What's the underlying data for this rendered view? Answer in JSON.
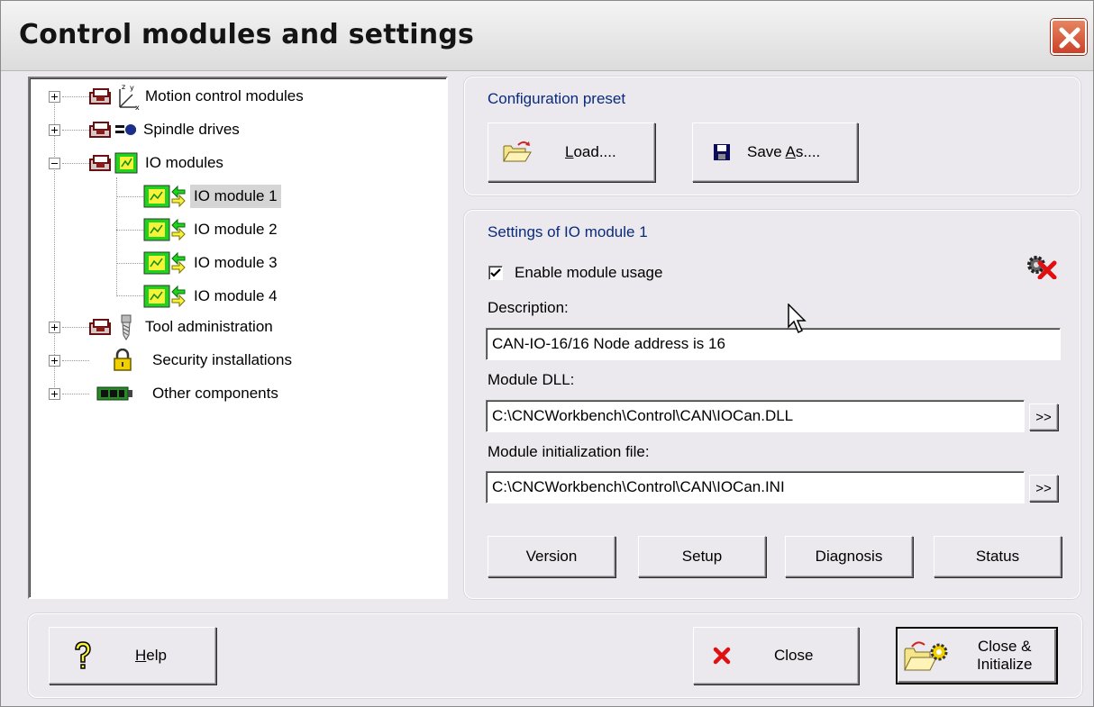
{
  "window": {
    "title": "Control modules and settings"
  },
  "tree": {
    "items": [
      {
        "label": "Motion control modules",
        "icon": "axes-icon",
        "expanded": false
      },
      {
        "label": "Spindle drives",
        "icon": "spindle-icon",
        "expanded": false
      },
      {
        "label": "IO modules",
        "icon": "io-board-icon",
        "expanded": true
      },
      {
        "label": "IO module 1",
        "icon": "io-module-icon",
        "selected": true
      },
      {
        "label": "IO module 2",
        "icon": "io-module-icon"
      },
      {
        "label": "IO module 3",
        "icon": "io-module-icon"
      },
      {
        "label": "IO module 4",
        "icon": "io-module-icon"
      },
      {
        "label": "Tool administration",
        "icon": "tool-icon",
        "expanded": false
      },
      {
        "label": "Security installations",
        "icon": "padlock-icon",
        "expanded": false
      },
      {
        "label": "Other components",
        "icon": "circuit-board-icon",
        "expanded": false
      }
    ]
  },
  "preset": {
    "title": "Configuration preset",
    "load_pre": "",
    "load_mnemonic": "L",
    "load_post": "oad....",
    "save_pre": "Save ",
    "save_mnemonic": "A",
    "save_post": "s...."
  },
  "settings": {
    "title": "Settings of IO module 1",
    "enable_label": "Enable module usage",
    "enable_checked": true,
    "description_label": "Description:",
    "description_value": "CAN-IO-16/16 Node address is 16",
    "dll_label": "Module DLL:",
    "dll_value": "C:\\CNCWorkbench\\Control\\CAN\\IOCan.DLL",
    "init_label": "Module initialization file:",
    "init_value": "C:\\CNCWorkbench\\Control\\CAN\\IOCan.INI",
    "browse_label": ">>",
    "buttons": {
      "version": "Version",
      "setup": "Setup",
      "diagnosis": "Diagnosis",
      "status": "Status"
    }
  },
  "footer": {
    "help_mnemonic": "H",
    "help_post": "elp",
    "close": "Close",
    "close_init_line1": "Close &",
    "close_init_line2": "Initialize"
  },
  "colors": {
    "panel_title": "#0a2a7c",
    "io_green": "#1fd31f",
    "io_yellow": "#f7f23a",
    "close_red": "#c9422a"
  }
}
